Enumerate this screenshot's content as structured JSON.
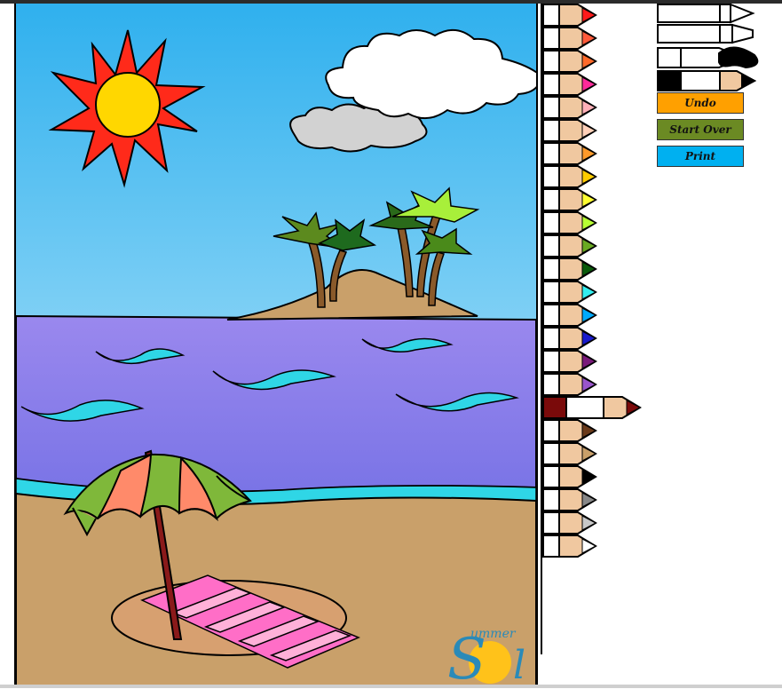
{
  "controls": {
    "undo_label": "Undo",
    "start_over_label": "Start Over",
    "print_label": "Print"
  },
  "logo": {
    "word_top": "ummer",
    "word_main": "Sol"
  },
  "palette": {
    "selected_color": "#7a0a0a",
    "colors": [
      "#ff1a1a",
      "#ff5a3a",
      "#ff6a2a",
      "#ff2a9a",
      "#ffb0b8",
      "#ffd0b8",
      "#ff9a2a",
      "#ffcc00",
      "#ffff33",
      "#b8ff33",
      "#6aaa22",
      "#0a5a0a",
      "#33eeee",
      "#00aaff",
      "#1a1acc",
      "#7a1a7a",
      "#9a55cc",
      "#7a0a0a",
      "#6a3a1a",
      "#c9a06a",
      "#000000",
      "#888888",
      "#c8c8c8",
      "#ffffff"
    ]
  },
  "colors": {
    "sky": "#38b6ef",
    "sea": "#8a7be8",
    "sand": "#c9a06a",
    "sun": "#ffd700",
    "sun_rays": "#ff2a1a",
    "button_undo": "#ffa000",
    "button_start_over": "#6b8a23",
    "button_print": "#00b0f0"
  }
}
